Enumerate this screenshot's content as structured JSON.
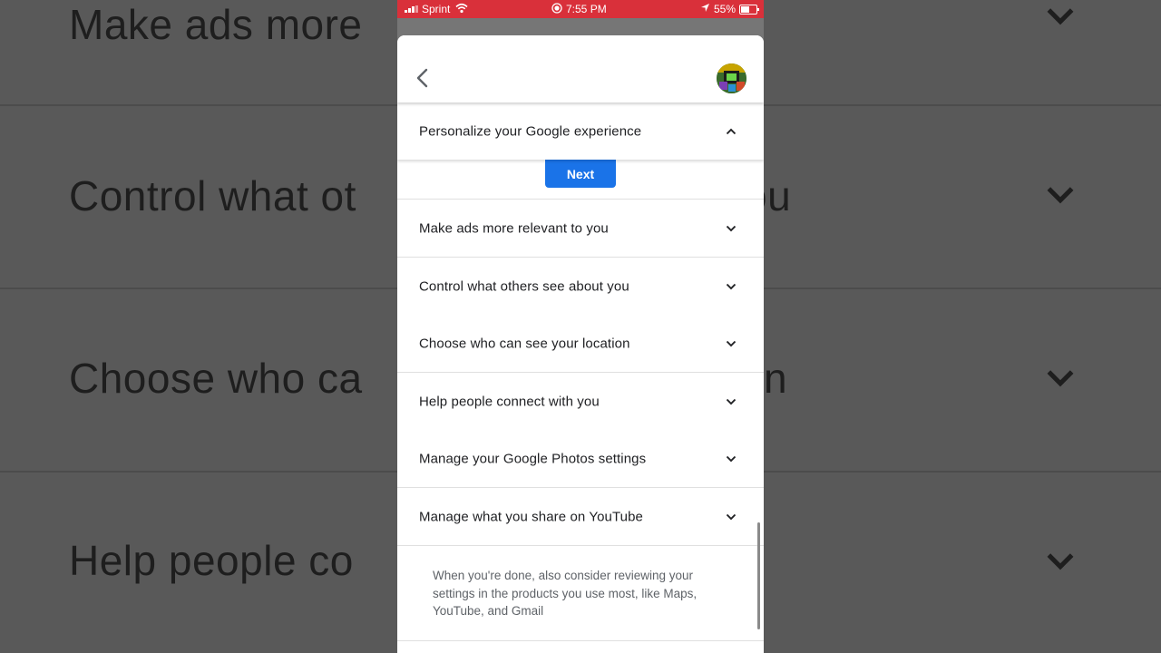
{
  "status_bar": {
    "carrier": "Sprint",
    "time": "7:55 PM",
    "battery": "55%"
  },
  "background": {
    "labels": [
      "Make ads more",
      "Control what ot",
      "Choose who ca",
      "Help people co"
    ],
    "labels_right": [
      "",
      "ou",
      "n",
      ""
    ]
  },
  "settings": {
    "expanded_section": {
      "label": "Personalize your Google experience",
      "next_label": "Next"
    },
    "sections": [
      {
        "label": "Make ads more relevant to you"
      },
      {
        "label": "Control what others see about you"
      },
      {
        "label": "Choose who can see your location"
      },
      {
        "label": "Help people connect with you"
      },
      {
        "label": "Manage your Google Photos settings"
      },
      {
        "label": "Manage what you share on YouTube"
      }
    ],
    "footer_note": "When you're done, also consider reviewing your settings in the products you use most, like Maps, YouTube, and Gmail"
  },
  "icons": {
    "back": "arrow-back-icon",
    "chevron_down": "chevron-down-icon",
    "chevron_up": "chevron-up-icon",
    "avatar": "avatar"
  },
  "colors": {
    "status_bar": "#d9303a",
    "accent": "#1a73e8"
  }
}
